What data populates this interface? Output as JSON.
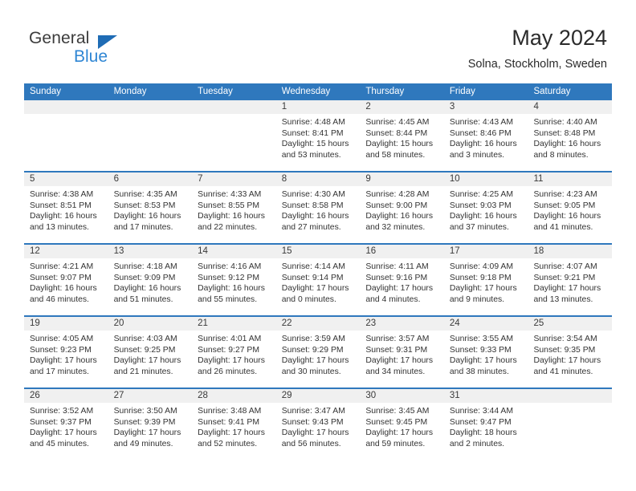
{
  "logo": {
    "word_one": "General",
    "word_two": "Blue",
    "triangle_icon": "triangle-icon",
    "accent_dark": "#1f6cb5",
    "accent_light": "#2f86d4"
  },
  "header": {
    "title": "May 2024",
    "location": "Solna, Stockholm, Sweden"
  },
  "theme": {
    "header_blue": "#2f78bd",
    "daynum_band": "#f0f0f0",
    "text": "#333333"
  },
  "weekdays": [
    "Sunday",
    "Monday",
    "Tuesday",
    "Wednesday",
    "Thursday",
    "Friday",
    "Saturday"
  ],
  "weeks": [
    [
      {
        "day": "",
        "empty": true
      },
      {
        "day": "",
        "empty": true
      },
      {
        "day": "",
        "empty": true
      },
      {
        "day": "1",
        "sunrise": "Sunrise: 4:48 AM",
        "sunset": "Sunset: 8:41 PM",
        "daylight": "Daylight: 15 hours and 53 minutes."
      },
      {
        "day": "2",
        "sunrise": "Sunrise: 4:45 AM",
        "sunset": "Sunset: 8:44 PM",
        "daylight": "Daylight: 15 hours and 58 minutes."
      },
      {
        "day": "3",
        "sunrise": "Sunrise: 4:43 AM",
        "sunset": "Sunset: 8:46 PM",
        "daylight": "Daylight: 16 hours and 3 minutes."
      },
      {
        "day": "4",
        "sunrise": "Sunrise: 4:40 AM",
        "sunset": "Sunset: 8:48 PM",
        "daylight": "Daylight: 16 hours and 8 minutes."
      }
    ],
    [
      {
        "day": "5",
        "sunrise": "Sunrise: 4:38 AM",
        "sunset": "Sunset: 8:51 PM",
        "daylight": "Daylight: 16 hours and 13 minutes."
      },
      {
        "day": "6",
        "sunrise": "Sunrise: 4:35 AM",
        "sunset": "Sunset: 8:53 PM",
        "daylight": "Daylight: 16 hours and 17 minutes."
      },
      {
        "day": "7",
        "sunrise": "Sunrise: 4:33 AM",
        "sunset": "Sunset: 8:55 PM",
        "daylight": "Daylight: 16 hours and 22 minutes."
      },
      {
        "day": "8",
        "sunrise": "Sunrise: 4:30 AM",
        "sunset": "Sunset: 8:58 PM",
        "daylight": "Daylight: 16 hours and 27 minutes."
      },
      {
        "day": "9",
        "sunrise": "Sunrise: 4:28 AM",
        "sunset": "Sunset: 9:00 PM",
        "daylight": "Daylight: 16 hours and 32 minutes."
      },
      {
        "day": "10",
        "sunrise": "Sunrise: 4:25 AM",
        "sunset": "Sunset: 9:03 PM",
        "daylight": "Daylight: 16 hours and 37 minutes."
      },
      {
        "day": "11",
        "sunrise": "Sunrise: 4:23 AM",
        "sunset": "Sunset: 9:05 PM",
        "daylight": "Daylight: 16 hours and 41 minutes."
      }
    ],
    [
      {
        "day": "12",
        "sunrise": "Sunrise: 4:21 AM",
        "sunset": "Sunset: 9:07 PM",
        "daylight": "Daylight: 16 hours and 46 minutes."
      },
      {
        "day": "13",
        "sunrise": "Sunrise: 4:18 AM",
        "sunset": "Sunset: 9:09 PM",
        "daylight": "Daylight: 16 hours and 51 minutes."
      },
      {
        "day": "14",
        "sunrise": "Sunrise: 4:16 AM",
        "sunset": "Sunset: 9:12 PM",
        "daylight": "Daylight: 16 hours and 55 minutes."
      },
      {
        "day": "15",
        "sunrise": "Sunrise: 4:14 AM",
        "sunset": "Sunset: 9:14 PM",
        "daylight": "Daylight: 17 hours and 0 minutes."
      },
      {
        "day": "16",
        "sunrise": "Sunrise: 4:11 AM",
        "sunset": "Sunset: 9:16 PM",
        "daylight": "Daylight: 17 hours and 4 minutes."
      },
      {
        "day": "17",
        "sunrise": "Sunrise: 4:09 AM",
        "sunset": "Sunset: 9:18 PM",
        "daylight": "Daylight: 17 hours and 9 minutes."
      },
      {
        "day": "18",
        "sunrise": "Sunrise: 4:07 AM",
        "sunset": "Sunset: 9:21 PM",
        "daylight": "Daylight: 17 hours and 13 minutes."
      }
    ],
    [
      {
        "day": "19",
        "sunrise": "Sunrise: 4:05 AM",
        "sunset": "Sunset: 9:23 PM",
        "daylight": "Daylight: 17 hours and 17 minutes."
      },
      {
        "day": "20",
        "sunrise": "Sunrise: 4:03 AM",
        "sunset": "Sunset: 9:25 PM",
        "daylight": "Daylight: 17 hours and 21 minutes."
      },
      {
        "day": "21",
        "sunrise": "Sunrise: 4:01 AM",
        "sunset": "Sunset: 9:27 PM",
        "daylight": "Daylight: 17 hours and 26 minutes."
      },
      {
        "day": "22",
        "sunrise": "Sunrise: 3:59 AM",
        "sunset": "Sunset: 9:29 PM",
        "daylight": "Daylight: 17 hours and 30 minutes."
      },
      {
        "day": "23",
        "sunrise": "Sunrise: 3:57 AM",
        "sunset": "Sunset: 9:31 PM",
        "daylight": "Daylight: 17 hours and 34 minutes."
      },
      {
        "day": "24",
        "sunrise": "Sunrise: 3:55 AM",
        "sunset": "Sunset: 9:33 PM",
        "daylight": "Daylight: 17 hours and 38 minutes."
      },
      {
        "day": "25",
        "sunrise": "Sunrise: 3:54 AM",
        "sunset": "Sunset: 9:35 PM",
        "daylight": "Daylight: 17 hours and 41 minutes."
      }
    ],
    [
      {
        "day": "26",
        "sunrise": "Sunrise: 3:52 AM",
        "sunset": "Sunset: 9:37 PM",
        "daylight": "Daylight: 17 hours and 45 minutes."
      },
      {
        "day": "27",
        "sunrise": "Sunrise: 3:50 AM",
        "sunset": "Sunset: 9:39 PM",
        "daylight": "Daylight: 17 hours and 49 minutes."
      },
      {
        "day": "28",
        "sunrise": "Sunrise: 3:48 AM",
        "sunset": "Sunset: 9:41 PM",
        "daylight": "Daylight: 17 hours and 52 minutes."
      },
      {
        "day": "29",
        "sunrise": "Sunrise: 3:47 AM",
        "sunset": "Sunset: 9:43 PM",
        "daylight": "Daylight: 17 hours and 56 minutes."
      },
      {
        "day": "30",
        "sunrise": "Sunrise: 3:45 AM",
        "sunset": "Sunset: 9:45 PM",
        "daylight": "Daylight: 17 hours and 59 minutes."
      },
      {
        "day": "31",
        "sunrise": "Sunrise: 3:44 AM",
        "sunset": "Sunset: 9:47 PM",
        "daylight": "Daylight: 18 hours and 2 minutes."
      },
      {
        "day": "",
        "empty": true
      }
    ]
  ]
}
